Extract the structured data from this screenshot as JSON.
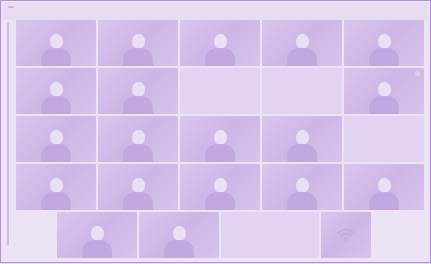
{
  "meeting": {
    "names": [
      "",
      "",
      "",
      "",
      "",
      "",
      "",
      "",
      "",
      "",
      "",
      "",
      "",
      "",
      "",
      "",
      "",
      "",
      "",
      "",
      "",
      "",
      "",
      "",
      ""
    ],
    "center_labels": {
      "r2c3": "",
      "r2c4": "",
      "r3c5": "",
      "r5_center": ""
    }
  },
  "colors": {
    "tint": "#ece3f6",
    "border": "#b48fd6",
    "tile": "#d9c6ee"
  },
  "icons": {
    "status_icon": "reaction-icon",
    "network_icon": "wifi-icon"
  }
}
